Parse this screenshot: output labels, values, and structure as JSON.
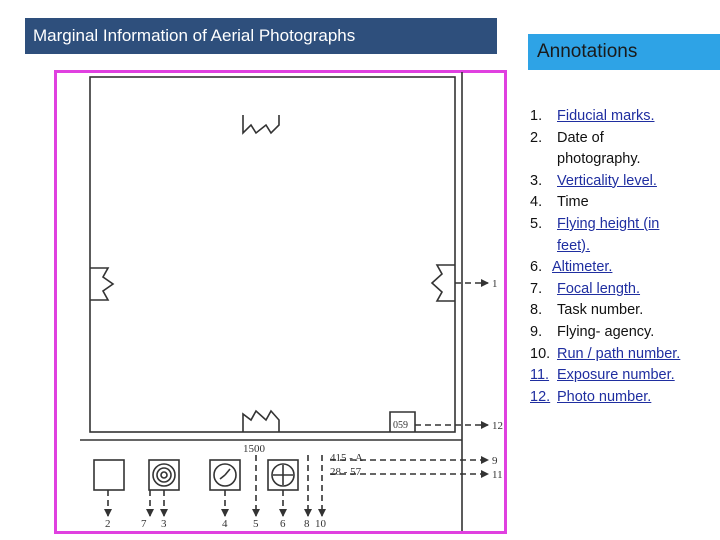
{
  "title": "Marginal Information of Aerial Photographs",
  "annotations_header": "Annotations",
  "annotations": [
    {
      "num": "1.",
      "text": "Fiducial marks.",
      "link": true
    },
    {
      "num": "2.",
      "text": "Date of",
      "cont": "photography.",
      "link": false
    },
    {
      "num": "3.",
      "text": "Verticality level.",
      "link": true
    },
    {
      "num": "4.",
      "text": "Time",
      "link": false
    },
    {
      "num": "5.",
      "text": "Flying height (in",
      "cont": "feet).",
      "link": true
    },
    {
      "num": "6.",
      "text": "Altimeter.",
      "link": true
    },
    {
      "num": "7.",
      "text": "Focal length.",
      "link": true
    },
    {
      "num": "8.",
      "text": "Task number.",
      "link": false
    },
    {
      "num": "9.",
      "text": "Flying- agency.",
      "link": false
    },
    {
      "num": "10.",
      "text": "Run / path number.",
      "link": true
    },
    {
      "num": "11.",
      "text": "Exposure number.",
      "link": true
    },
    {
      "num": "12.",
      "text": "Photo number.",
      "link": true
    }
  ],
  "diagram": {
    "photo_number_text": "059",
    "flying_height_text": "1500",
    "task_text": "415 - A",
    "run_exposure_text": "28 - 57",
    "right_labels": [
      "1",
      "12",
      "9",
      "11"
    ],
    "bottom_labels": [
      "2",
      "7",
      "3",
      "4",
      "5",
      "6",
      "8",
      "10"
    ]
  },
  "colors": {
    "title_bg": "#2e4f7c",
    "annotations_bg": "#2ea3e6",
    "frame_border": "#e040e0",
    "link_text": "#1f2ea0"
  }
}
